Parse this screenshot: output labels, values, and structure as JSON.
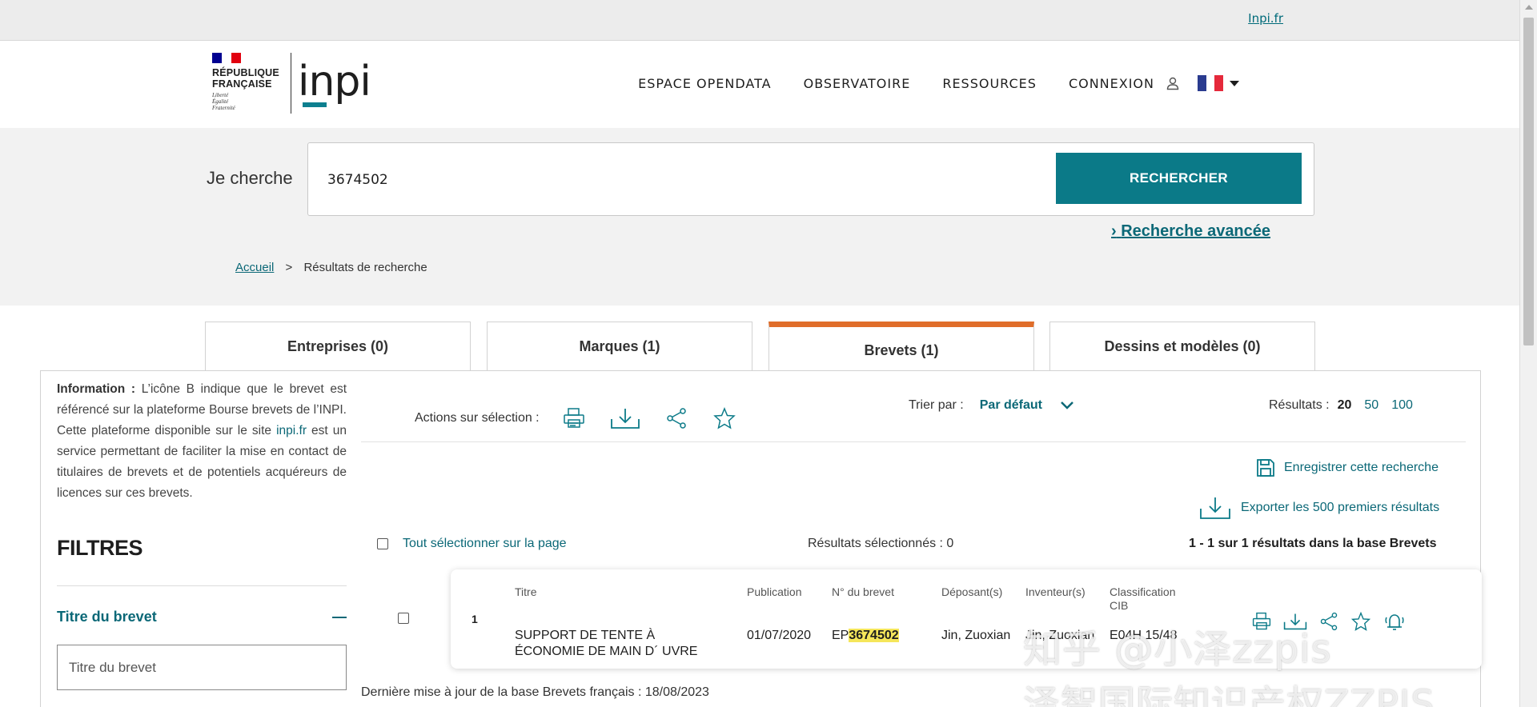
{
  "topbar": {
    "link": "Inpi.fr"
  },
  "header": {
    "rf_name_line1": "RÉPUBLIQUE",
    "rf_name_line2": "FRANÇAISE",
    "rf_motto_line1": "Liberté",
    "rf_motto_line2": "Égalité",
    "rf_motto_line3": "Fraternité",
    "logo_text": "inpi",
    "nav": [
      {
        "label": "ESPACE OPENDATA"
      },
      {
        "label": "OBSERVATOIRE"
      },
      {
        "label": "RESSOURCES"
      },
      {
        "label": "CONNEXION"
      }
    ],
    "icons": {
      "user": "user-icon",
      "language": "flag-fr-icon"
    }
  },
  "search": {
    "label": "Je cherche",
    "query": "3674502",
    "button": "RECHERCHER",
    "advanced_prefix": "›",
    "advanced": "Recherche avancée"
  },
  "breadcrumb": {
    "home": "Accueil",
    "separator": ">",
    "current": "Résultats de recherche"
  },
  "tabs": [
    {
      "label": "Entreprises (0)"
    },
    {
      "label": "Marques (1)"
    },
    {
      "label": "Brevets (1)",
      "active": true
    },
    {
      "label": "Dessins et modèles (0)"
    }
  ],
  "info": {
    "title": "Information :",
    "text1": " L’icône B indique que le brevet est référencé sur la plateforme Bourse brevets de l’INPI. Cette plateforme disponible sur le site ",
    "link": "inpi.fr",
    "text2": " est un service permettant de faciliter la mise en contact de titulaires de brevets et de potentiels acquéreurs de licences sur ces brevets."
  },
  "filters": {
    "title": "FILTRES",
    "section": "Titre du brevet",
    "placeholder": "Titre du brevet"
  },
  "toolbar": {
    "actions_label": "Actions sur sélection :",
    "sort_label": "Trier par :",
    "sort_value": "Par défaut",
    "per_page_label": "Résultats :",
    "per_page_options": [
      "20",
      "50",
      "100"
    ],
    "save_search": "Enregistrer cette recherche",
    "export": "Exporter les 500 premiers résultats"
  },
  "results": {
    "select_all": "Tout sélectionner sur la page",
    "selected_count": "Résultats sélectionnés : 0",
    "summary": "1 - 1 sur 1 résultats dans la base Brevets",
    "headers": {
      "title": "Titre",
      "publication": "Publication",
      "number": "N° du brevet",
      "applicant": "Déposant(s)",
      "inventor": "Inventeur(s)",
      "classification_line1": "Classification",
      "classification_line2": "CIB"
    },
    "rows": [
      {
        "index": "1",
        "title_line1": "SUPPORT DE TENTE À",
        "title_line2": "ÉCONOMIE DE MAIN D´ UVRE",
        "publication": "01/07/2020",
        "number_prefix": "EP",
        "number_highlight": "3674502",
        "applicant": "Jin, Zuoxian",
        "inventor": "Jin, Zuoxian",
        "classification": "E04H 15/48"
      }
    ],
    "last_update": "Dernière mise à jour de la base Brevets français : 18/08/2023"
  },
  "watermark": {
    "line1": "知乎 @小泽zzpis",
    "line2": "泽智国际知识产权ZZPIS"
  },
  "colors": {
    "accent": "#0b7a88",
    "active_tab": "#e06d2a",
    "highlight": "#f5e65a"
  }
}
